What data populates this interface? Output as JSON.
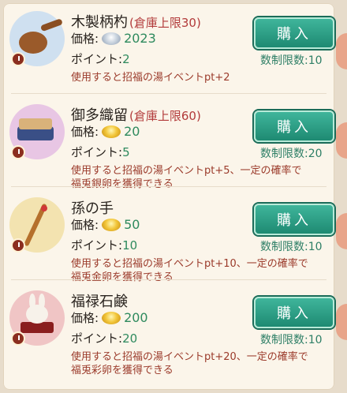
{
  "items": [
    {
      "name": "木製柄杓",
      "stock": "(倉庫上限30)",
      "price_label": "価格:",
      "price": "2023",
      "coin": "silver",
      "points_label": "ポイント:",
      "points": "2",
      "desc1": "使用すると招福の湯イベントpt+2",
      "desc2": "",
      "buy": "購入",
      "limit": "数制限数:10",
      "bg": "#cfe0f0"
    },
    {
      "name": "御多織留",
      "stock": "(倉庫上限60)",
      "price_label": "価格:",
      "price": "20",
      "coin": "gold",
      "points_label": "ポイント:",
      "points": "5",
      "desc1": "使用すると招福の湯イベントpt+5、一定の確率で",
      "desc2": "福兎銀卵を獲得できる",
      "buy": "購入",
      "limit": "数制限数:20",
      "bg": "#e8c6e4"
    },
    {
      "name": "孫の手",
      "stock": "",
      "price_label": "価格:",
      "price": "50",
      "coin": "gold",
      "points_label": "ポイント:",
      "points": "10",
      "desc1": "使用すると招福の湯イベントpt+10、一定の確率で",
      "desc2": "福兎金卵を獲得できる",
      "buy": "購入",
      "limit": "数制限数:10",
      "bg": "#f3e3b0"
    },
    {
      "name": "福禄石鹸",
      "stock": "",
      "price_label": "価格:",
      "price": "200",
      "coin": "gold",
      "points_label": "ポイント:",
      "points": "20",
      "desc1": "使用すると招福の湯イベントpt+20、一定の確率で",
      "desc2": "福兎彩卵を獲得できる",
      "buy": "購入",
      "limit": "数制限数:10",
      "bg": "#f0c5c5"
    }
  ]
}
